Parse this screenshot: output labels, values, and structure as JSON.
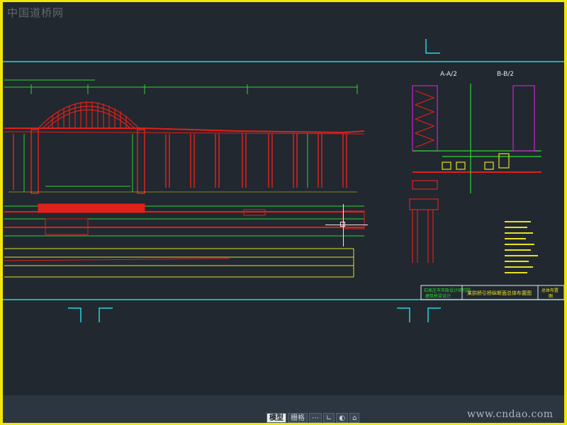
{
  "watermarks": {
    "top_left": "中国道桥网",
    "bottom_right": "www.cndao.com"
  },
  "colors": {
    "canvas_bg": "#212830",
    "window_border": "#f2e60a",
    "cyan": "#20d8e0",
    "red": "#e0201a",
    "green": "#2fd42f",
    "yellow": "#e8e020",
    "magenta": "#d020d0",
    "white": "#e8e8e8"
  },
  "sections": {
    "section_a": "A-A/2",
    "section_b": "B-B/2"
  },
  "title_block": {
    "left_line1": "石家庄市市政设计研究院",
    "left_line2": "建筑桥梁设计",
    "middle": "某拱桥引桥纵断面总体布置图",
    "right_line1": "总体布置",
    "right_line2": "图"
  },
  "status": {
    "model_tab": "模型",
    "grid_label": "栅格"
  }
}
